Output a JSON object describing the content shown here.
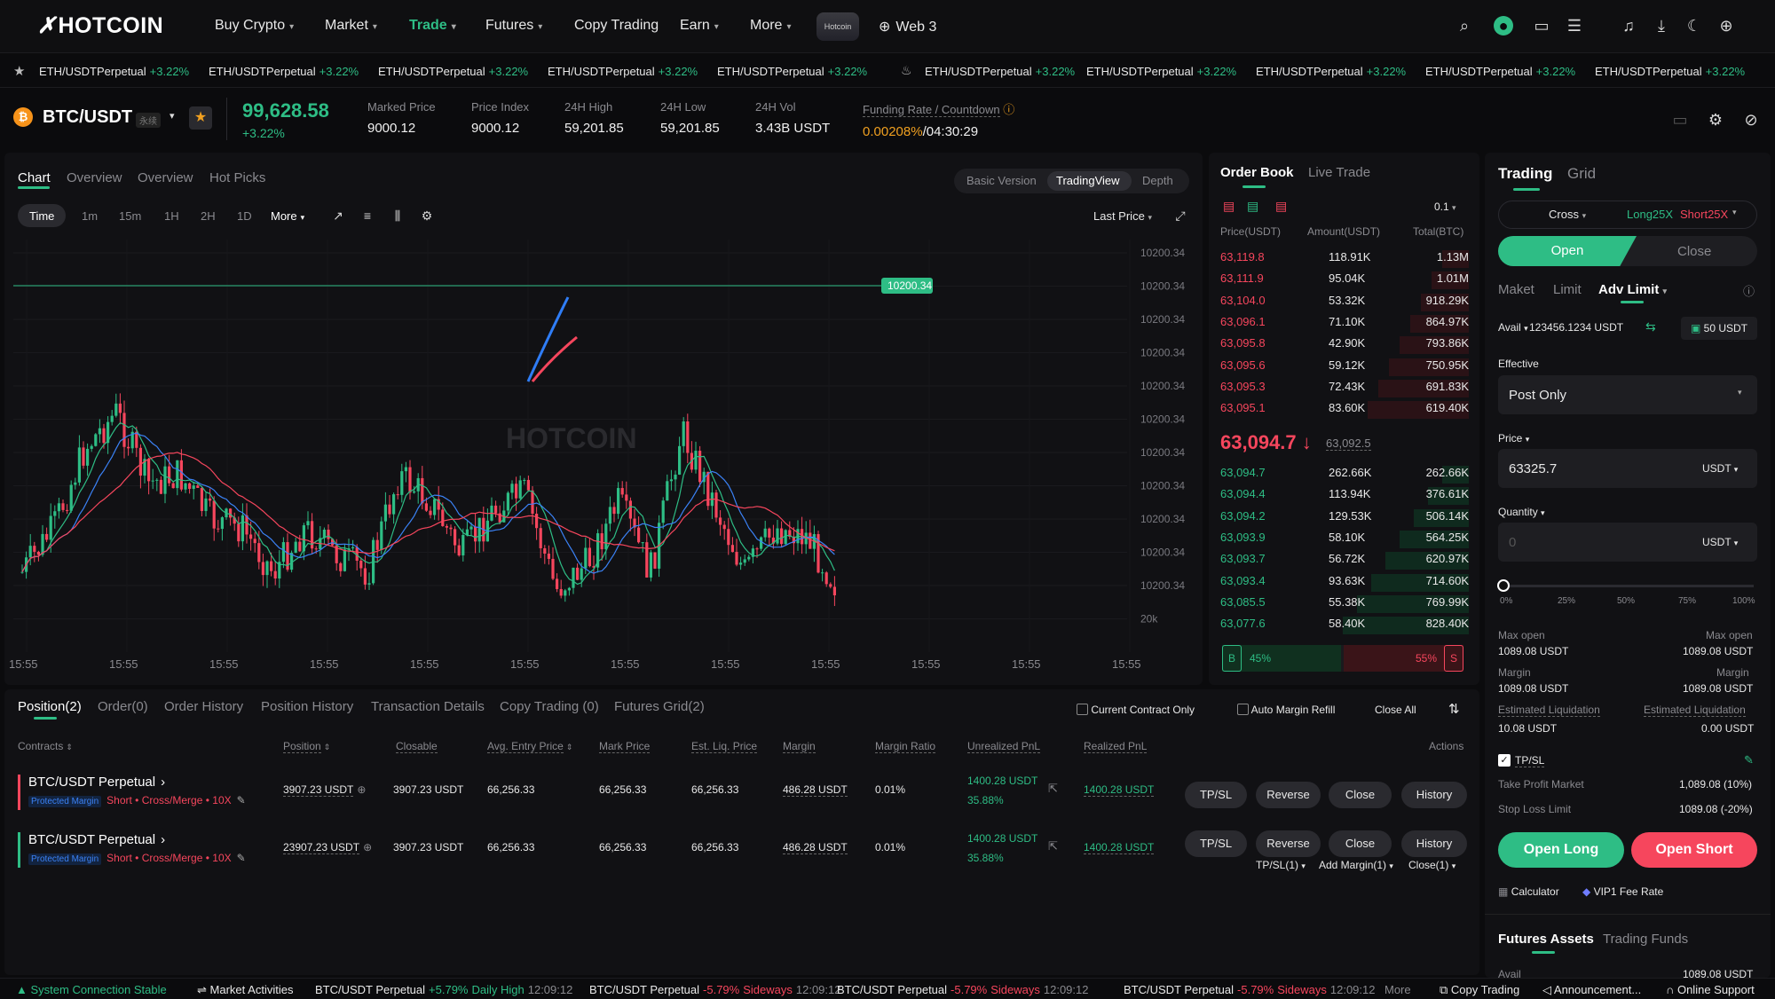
{
  "nav": {
    "logo": "HOTCOIN",
    "items": [
      {
        "label": "Buy Crypto",
        "caret": true
      },
      {
        "label": "Market",
        "caret": true
      },
      {
        "label": "Trade",
        "caret": true,
        "active": true
      },
      {
        "label": "Futures",
        "caret": true
      },
      {
        "label": "Copy Trading",
        "caret": false
      },
      {
        "label": "Earn",
        "caret": true
      },
      {
        "label": "More",
        "caret": true
      }
    ],
    "web3": "Web 3",
    "brand_badge": "Hotcoin"
  },
  "ticker": {
    "items": [
      "ETH/USDTPerpetual",
      "ETH/USDTPerpetual",
      "ETH/USDTPerpetual",
      "ETH/USDTPerpetual",
      "ETH/USDTPerpetual",
      "ETH/USDTPerpetual",
      "ETH/USDTPerpetual",
      "ETH/USDTPerpetual",
      "ETH/USDTPerpetual",
      "ETH/USDTPerpetual"
    ],
    "change": "+3.22%"
  },
  "header": {
    "pair": "BTC/USDT",
    "pair_tag": "永续",
    "price": "99,628.58",
    "change": "+3.22%",
    "stats": [
      {
        "label": "Marked Price",
        "value": "9000.12"
      },
      {
        "label": "Price Index",
        "value": "9000.12"
      },
      {
        "label": "24H High",
        "value": "59,201.85"
      },
      {
        "label": "24H Low",
        "value": "59,201.85"
      },
      {
        "label": "24H Vol",
        "value": "3.43B USDT"
      }
    ],
    "funding_label": "Funding Rate / Countdown",
    "funding_rate": "0.00208%",
    "countdown": "/04:30:29"
  },
  "chart": {
    "tabs": [
      "Chart",
      "Overview",
      "Overview",
      "Hot Picks"
    ],
    "views": [
      "Basic Version",
      "TradingView",
      "Depth"
    ],
    "intervals": [
      "Time",
      "1m",
      "15m",
      "1H",
      "2H",
      "1D",
      "More"
    ],
    "last_price": "Last Price",
    "price_tag": "10200.34",
    "y_labels": [
      "10200.34",
      "10200.34",
      "10200.34",
      "10200.34",
      "10200.34",
      "10200.34",
      "10200.34",
      "10200.34",
      "10200.34",
      "10200.34",
      "10200.34",
      "20k"
    ],
    "x_labels": [
      "15:55",
      "15:55",
      "15:55",
      "15:55",
      "15:55",
      "15:55",
      "15:55",
      "15:55",
      "15:55",
      "15:55",
      "15:55",
      "15:55"
    ],
    "watermark": "HOTCOIN"
  },
  "orderbook": {
    "tabs": [
      "Order Book",
      "Live Trade"
    ],
    "precision": "0.1",
    "headers": [
      "Price(USDT)",
      "Amount(USDT)",
      "Total(BTC)"
    ],
    "asks": [
      [
        "63,119.8",
        "118.91K",
        "1.13M"
      ],
      [
        "63,111.9",
        "95.04K",
        "1.01M"
      ],
      [
        "63,104.0",
        "53.32K",
        "918.29K"
      ],
      [
        "63,096.1",
        "71.10K",
        "864.97K"
      ],
      [
        "63,095.8",
        "42.90K",
        "793.86K"
      ],
      [
        "63,095.6",
        "59.12K",
        "750.95K"
      ],
      [
        "63,095.3",
        "72.43K",
        "691.83K"
      ],
      [
        "63,095.1",
        "83.60K",
        "619.40K"
      ]
    ],
    "last": "63,094.7",
    "last_arrow": "↓",
    "mark": "63,092.5",
    "bids": [
      [
        "63,094.7",
        "262.66K",
        "262.66K"
      ],
      [
        "63,094.4",
        "113.94K",
        "376.61K"
      ],
      [
        "63,094.2",
        "129.53K",
        "506.14K"
      ],
      [
        "63,093.9",
        "58.10K",
        "564.25K"
      ],
      [
        "63,093.7",
        "56.72K",
        "620.97K"
      ],
      [
        "63,093.4",
        "93.63K",
        "714.60K"
      ],
      [
        "63,085.5",
        "55.38K",
        "769.99K"
      ],
      [
        "63,077.6",
        "58.40K",
        "828.40K"
      ]
    ],
    "buy_pct": "45%",
    "sell_pct": "55%",
    "b": "B",
    "s": "S"
  },
  "trading": {
    "tabs": [
      "Trading",
      "Grid"
    ],
    "margin_mode": "Cross",
    "long_lev": "Long25X",
    "short_lev": "Short25X",
    "open": "Open",
    "close": "Close",
    "order_types": [
      "Maket",
      "Limit",
      "Adv Limit"
    ],
    "avail_label": "Avail",
    "avail_value": "123456.1234 USDT",
    "transfer": "50 USDT",
    "effective_label": "Effective",
    "effective_value": "Post Only",
    "price_label": "Price",
    "price_value": "63325.7",
    "unit": "USDT",
    "qty_label": "Quantity",
    "qty_placeholder": "0",
    "slider": [
      "0%",
      "25%",
      "50%",
      "75%",
      "100%"
    ],
    "max_open_l": "Max open",
    "max_open_lv": "1089.08 USDT",
    "max_open_r": "Max open",
    "max_open_rv": "1089.08 USDT",
    "margin_l": "Margin",
    "margin_lv": "1089.08 USDT",
    "margin_r": "Margin",
    "margin_rv": "1089.08 USDT",
    "liq_l": "Estimated Liquidation",
    "liq_lv": "10.08 USDT",
    "liq_r": "Estimated Liquidation",
    "liq_rv": "0.00 USDT",
    "tpsl": "TP/SL",
    "tp_label": "Take Profit Market",
    "tp_value": "1,089.08 (10%)",
    "sl_label": "Stop Loss Limit",
    "sl_value": "1089.08 (-20%)",
    "open_long": "Open Long",
    "open_short": "Open Short",
    "calculator": "Calculator",
    "fee": "VIP1 Fee Rate",
    "assets_tabs": [
      "Futures Assets",
      "Trading Funds"
    ],
    "avail2_label": "Avail",
    "avail2_value": "1089.08 USDT"
  },
  "positions": {
    "tabs": [
      "Position(2)",
      "Order(0)",
      "Order History",
      "Position History",
      "Transaction Details",
      "Copy Trading (0)",
      "Futures Grid(2)"
    ],
    "current_only": "Current Contract Only",
    "auto_refill": "Auto Margin Refill",
    "close_all": "Close All",
    "headers": [
      "Contracts",
      "Position",
      "Closable",
      "Avg. Entry Price",
      "Mark Price",
      "Est. Liq. Price",
      "Margin",
      "Margin Ratio",
      "Unrealized PnL",
      "Realized PnL",
      "Actions"
    ],
    "rows": [
      {
        "name": "BTC/USDT Perpetual",
        "tag": "Protected Margin",
        "side": "Short",
        "mode": "Cross/Merge",
        "lev": "10X",
        "position": "3907.23 USDT",
        "closable": "3907.23 USDT",
        "entry": "66,256.33",
        "mark": "66,256.33",
        "liq": "66,256.33",
        "margin": "486.28 USDT",
        "ratio": "0.01%",
        "upnl": "1400.28 USDT",
        "upnl_pct": "35.88%",
        "rpnl": "1400.28 USDT"
      },
      {
        "name": "BTC/USDT Perpetual",
        "tag": "Protected Margin",
        "side": "Short",
        "mode": "Cross/Merge",
        "lev": "10X",
        "position": "23907.23 USDT",
        "closable": "3907.23 USDT",
        "entry": "66,256.33",
        "mark": "66,256.33",
        "liq": "66,256.33",
        "margin": "486.28 USDT",
        "ratio": "0.01%",
        "upnl": "1400.28 USDT",
        "upnl_pct": "35.88%",
        "rpnl": "1400.28 USDT"
      }
    ],
    "actions": [
      "TP/SL",
      "Reverse",
      "Close",
      "History"
    ],
    "sub_actions": [
      "TP/SL(1)",
      "Add Margin(1)",
      "Close(1)"
    ]
  },
  "status": {
    "connection": "System Connection Stable",
    "market": "Market Activities",
    "items": [
      {
        "pair": "BTC/USDT Perpetual",
        "chg": "+5.79%",
        "note": "Daily High",
        "time": "12:09:12",
        "up": true
      },
      {
        "pair": "BTC/USDT Perpetual",
        "chg": "-5.79%",
        "note": "Sideways",
        "time": "12:09:12",
        "up": false
      },
      {
        "pair": "BTC/USDT Perpetual",
        "chg": "-5.79%",
        "note": "Sideways",
        "time": "12:09:12",
        "up": false
      },
      {
        "pair": "BTC/USDT Perpetual",
        "chg": "-5.79%",
        "note": "Sideways",
        "time": "12:09:12",
        "up": false
      }
    ],
    "more": "More",
    "copy": "Copy Trading",
    "announce": "Announcement...",
    "support": "Online Support"
  }
}
